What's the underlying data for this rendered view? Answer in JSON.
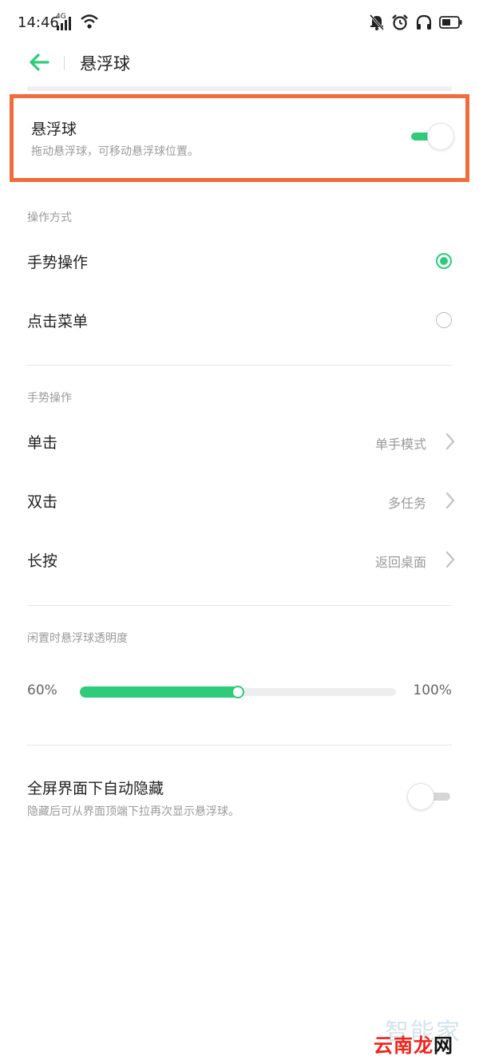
{
  "status_bar": {
    "time": "14:46",
    "network": "4G",
    "icons": [
      "signal-icon",
      "wifi-icon",
      "mute-notification-icon",
      "alarm-icon",
      "headphones-icon",
      "battery-icon"
    ]
  },
  "header": {
    "title": "悬浮球",
    "back_icon": "back-arrow-icon"
  },
  "floating_ball": {
    "title": "悬浮球",
    "description": "拖动悬浮球，可移动悬浮球位置。",
    "enabled": true
  },
  "operation_mode": {
    "header": "操作方式",
    "options": [
      {
        "label": "手势操作",
        "selected": true
      },
      {
        "label": "点击菜单",
        "selected": false
      }
    ]
  },
  "gesture_operation": {
    "header": "手势操作",
    "items": [
      {
        "label": "单击",
        "value": "单手模式"
      },
      {
        "label": "双击",
        "value": "多任务"
      },
      {
        "label": "长按",
        "value": "返回桌面"
      }
    ]
  },
  "idle_opacity": {
    "header": "闲置时悬浮球透明度",
    "min_label": "60%",
    "max_label": "100%",
    "level": 0.5
  },
  "auto_hide": {
    "title": "全屏界面下自动隐藏",
    "description": "隐藏后可从界面顶端下拉再次显示悬浮球。",
    "enabled": false
  },
  "watermarks": {
    "zhineng": "智能家",
    "yunnan": "云南",
    "long": "龙",
    "wang": "网"
  },
  "colors": {
    "accent": "#2dcb7a",
    "highlight_border": "#f26b3a",
    "watermark_red": "#f2221a"
  }
}
